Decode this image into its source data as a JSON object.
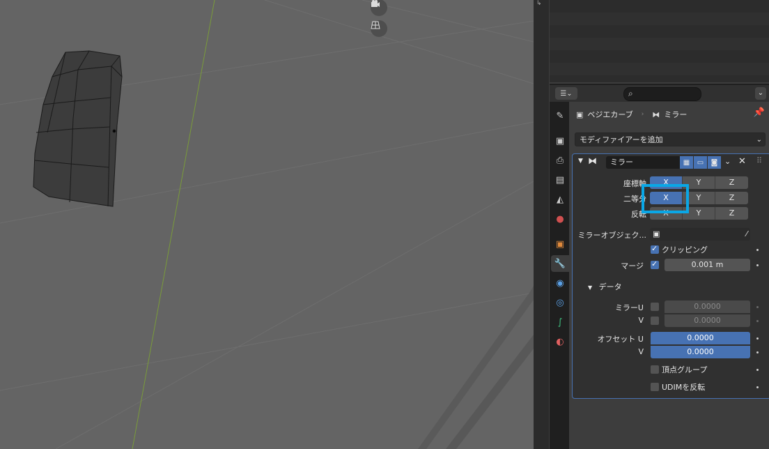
{
  "viewport": {
    "gizmo_icons": [
      "camera-icon",
      "grid-icon"
    ]
  },
  "properties": {
    "breadcrumb": {
      "object": "ベジエカーブ",
      "modifier": "ミラー"
    },
    "add_modifier": "モディファイアーを追加",
    "modifier": {
      "name": "ミラー",
      "axis_label": "座標軸",
      "bisect_label": "二等分",
      "flip_label": "反転",
      "axes": [
        "X",
        "Y",
        "Z"
      ],
      "axis_state": [
        true,
        false,
        false
      ],
      "bisect_state": [
        true,
        false,
        false
      ],
      "flip_state": [
        false,
        false,
        false
      ],
      "mirror_object_label": "ミラーオブジェク...",
      "clipping_label": "クリッピング",
      "clipping_checked": true,
      "merge_label": "マージ",
      "merge_checked": true,
      "merge_value": "0.001 m",
      "data_section": "データ",
      "mirror_u_label": "ミラーU",
      "mirror_v_label": "V",
      "mirror_u_value": "0.0000",
      "mirror_v_value": "0.0000",
      "offset_u_label": "オフセット U",
      "offset_v_label": "V",
      "offset_u_value": "0.0000",
      "offset_v_value": "0.0000",
      "vertex_groups_label": "頂点グループ",
      "udim_label": "UDIMを反転"
    }
  },
  "colors": {
    "accent": "#4772b3",
    "highlight": "#0aa7e6",
    "viewport_bg": "#646464"
  }
}
